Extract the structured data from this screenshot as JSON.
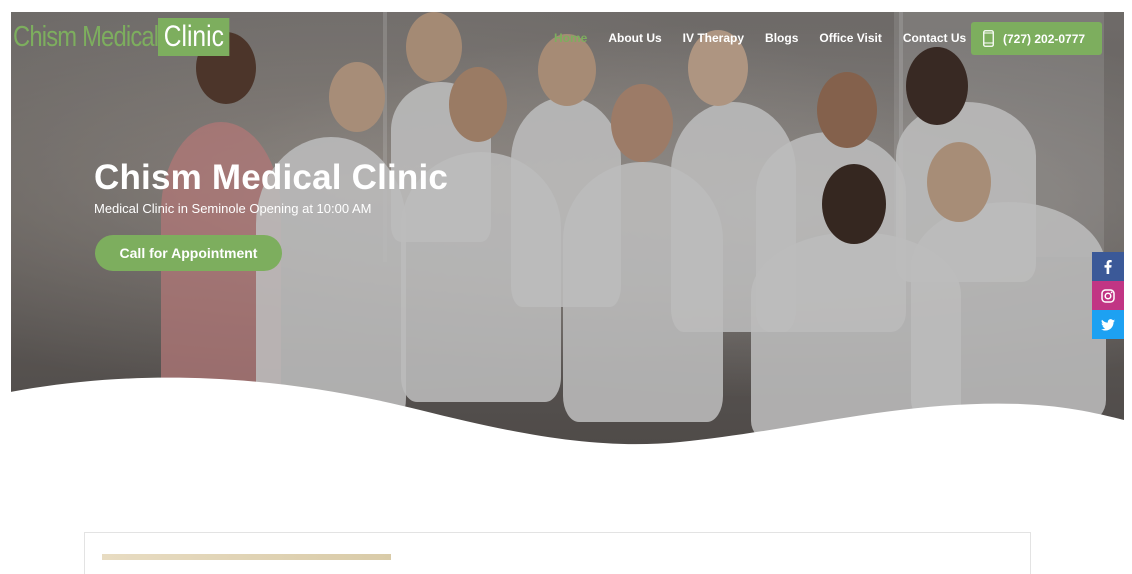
{
  "logo": {
    "text": "Chism Medical",
    "box_text": "Clinic"
  },
  "nav": {
    "items": [
      {
        "label": "Home",
        "active": true
      },
      {
        "label": "About Us",
        "active": false
      },
      {
        "label": "IV Therapy",
        "active": false
      },
      {
        "label": "Blogs",
        "active": false
      },
      {
        "label": "Office Visit",
        "active": false
      },
      {
        "label": "Contact Us",
        "active": false
      }
    ],
    "phone": "(727) 202-0777"
  },
  "hero": {
    "title": "Chism Medical Clinic",
    "subtitle": "Medical Clinic in Seminole Opening at 10:00 AM",
    "cta_label": "Call for Appointment"
  },
  "social": {
    "items": [
      {
        "icon": "facebook-icon",
        "color": "#3b5998"
      },
      {
        "icon": "instagram-icon",
        "color": "#c13584"
      },
      {
        "icon": "twitter-icon",
        "color": "#1da1f2"
      }
    ]
  },
  "colors": {
    "brand_green": "#7dae5e"
  }
}
